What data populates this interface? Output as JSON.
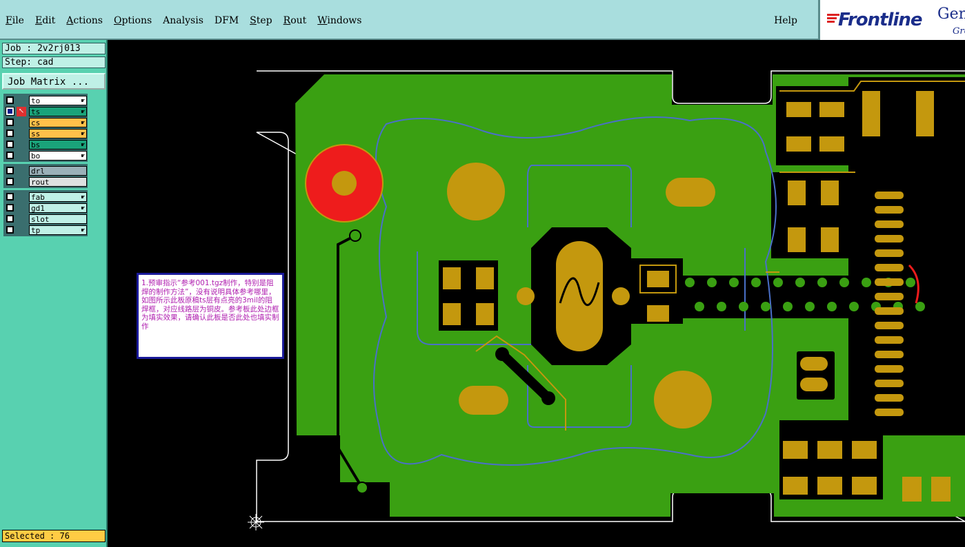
{
  "menu": {
    "items": [
      "File",
      "Edit",
      "Actions",
      "Options",
      "Analysis",
      "DFM",
      "Step",
      "Rout",
      "Windows"
    ],
    "help": "Help"
  },
  "logo": {
    "brand": "Frontline",
    "tail1": "Gen",
    "tail2": "Gro"
  },
  "side": {
    "job": "Job : 2v2rj013",
    "step": "Step: cad",
    "job_matrix": "Job Matrix ...",
    "selected": "Selected : 76"
  },
  "layer_groups": [
    [
      {
        "name": "to",
        "color": "#ffffff",
        "hand": true,
        "selected": false,
        "arrow": false
      },
      {
        "name": "ts",
        "color": "#1aa37a",
        "hand": true,
        "selected": true,
        "arrow": true
      },
      {
        "name": "cs",
        "color": "#ffc04a",
        "hand": true,
        "selected": false,
        "arrow": false
      },
      {
        "name": "ss",
        "color": "#ffc04a",
        "hand": true,
        "selected": false,
        "arrow": false
      },
      {
        "name": "bs",
        "color": "#1aa37a",
        "hand": true,
        "selected": false,
        "arrow": false
      },
      {
        "name": "bo",
        "color": "#ffffff",
        "hand": true,
        "selected": false,
        "arrow": false
      }
    ],
    [
      {
        "name": "drl",
        "color": "#9ab0b8",
        "hand": false,
        "selected": false,
        "arrow": false
      },
      {
        "name": "rout",
        "color": "#dde0e0",
        "hand": false,
        "selected": false,
        "arrow": false
      }
    ],
    [
      {
        "name": "fab",
        "color": "#bff0e6",
        "hand": true,
        "selected": false,
        "arrow": false
      },
      {
        "name": "gd1",
        "color": "#bff0e6",
        "hand": true,
        "selected": false,
        "arrow": false
      },
      {
        "name": "slot",
        "color": "#bff0e6",
        "hand": false,
        "selected": false,
        "arrow": false
      },
      {
        "name": "tp",
        "color": "#bff0e6",
        "hand": true,
        "selected": false,
        "arrow": false
      }
    ]
  ],
  "note": "1.预审指示“参考001.tgz制作，特别是阻焊的制作方法”，没有说明具体参考哪里，如图所示此板原稿ts层有点亮的3mil的阻焊框，对应线路层为铜皮。参考板此处边框为填实效果，请确认此板是否此处也填实制作",
  "colors": {
    "board": "#3aa012",
    "copper": "#c4980e",
    "outline": "#4a70c8",
    "bg": "#000000",
    "pad_red": "#ee1c1c"
  }
}
